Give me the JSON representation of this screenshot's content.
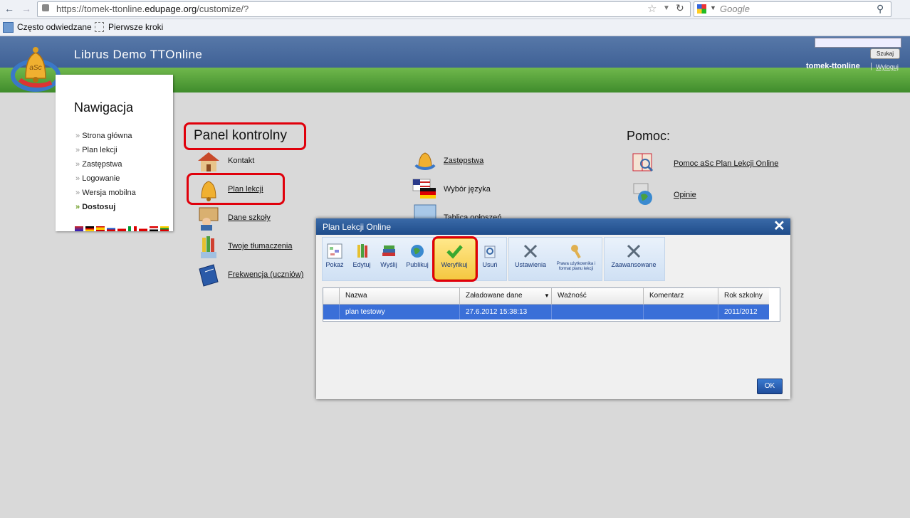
{
  "browser": {
    "url_prefix": "https://tomek-ttonline.",
    "url_host": "edupage.org",
    "url_path": "/customize/?",
    "search_placeholder": "Google",
    "bookmarks": [
      "Często odwiedzane",
      "Pierwsze kroki"
    ]
  },
  "header": {
    "title": "Librus Demo TTOnline",
    "search_button": "Szukaj",
    "user": "tomek-ttonline",
    "separator": "|",
    "logout": "Wyloguj"
  },
  "nav": {
    "title": "Nawigacja",
    "items": [
      "Strona główna",
      "Plan lekcji",
      "Zastępstwa",
      "Logowanie",
      "Wersja mobilna",
      "Dostosuj"
    ],
    "selected_index": 5
  },
  "panel": {
    "title": "Panel kontrolny",
    "links_left": [
      "Kontakt",
      "Plan lekcji",
      "Dane szkoły",
      "Twoje tłumaczenia",
      "Frekwencja (uczniów)"
    ],
    "links_mid": [
      "Zastępstwa",
      "Wybór języka",
      "Tablica ogłoszeń"
    ]
  },
  "help": {
    "title": "Pomoc:",
    "links": [
      "Pomoc aSc Plan Lekcji Online",
      "Opinie"
    ]
  },
  "dialog": {
    "title": "Plan Lekcji Online",
    "toolbar": [
      "Pokaż",
      "Edytuj",
      "Wyślij",
      "Publikuj",
      "Weryfikuj",
      "Usuń",
      "Ustawienia",
      "Prawa użytkownika i format planu lekcji",
      "Zaawansowane"
    ],
    "columns": [
      "Nazwa",
      "Załadowane dane",
      "Ważność",
      "Komentarz",
      "Rok szkolny"
    ],
    "rows": [
      {
        "nazwa": "plan testowy",
        "zaladowane": "27.6.2012 15:38:13",
        "waznosc": "",
        "komentarz": "",
        "rok": "2011/2012"
      }
    ],
    "ok": "OK"
  },
  "colors": {
    "accent_red": "#e0000b",
    "header_blue": "#3f6196",
    "header_green": "#4a9a34",
    "selection_blue": "#3a6fd8"
  }
}
